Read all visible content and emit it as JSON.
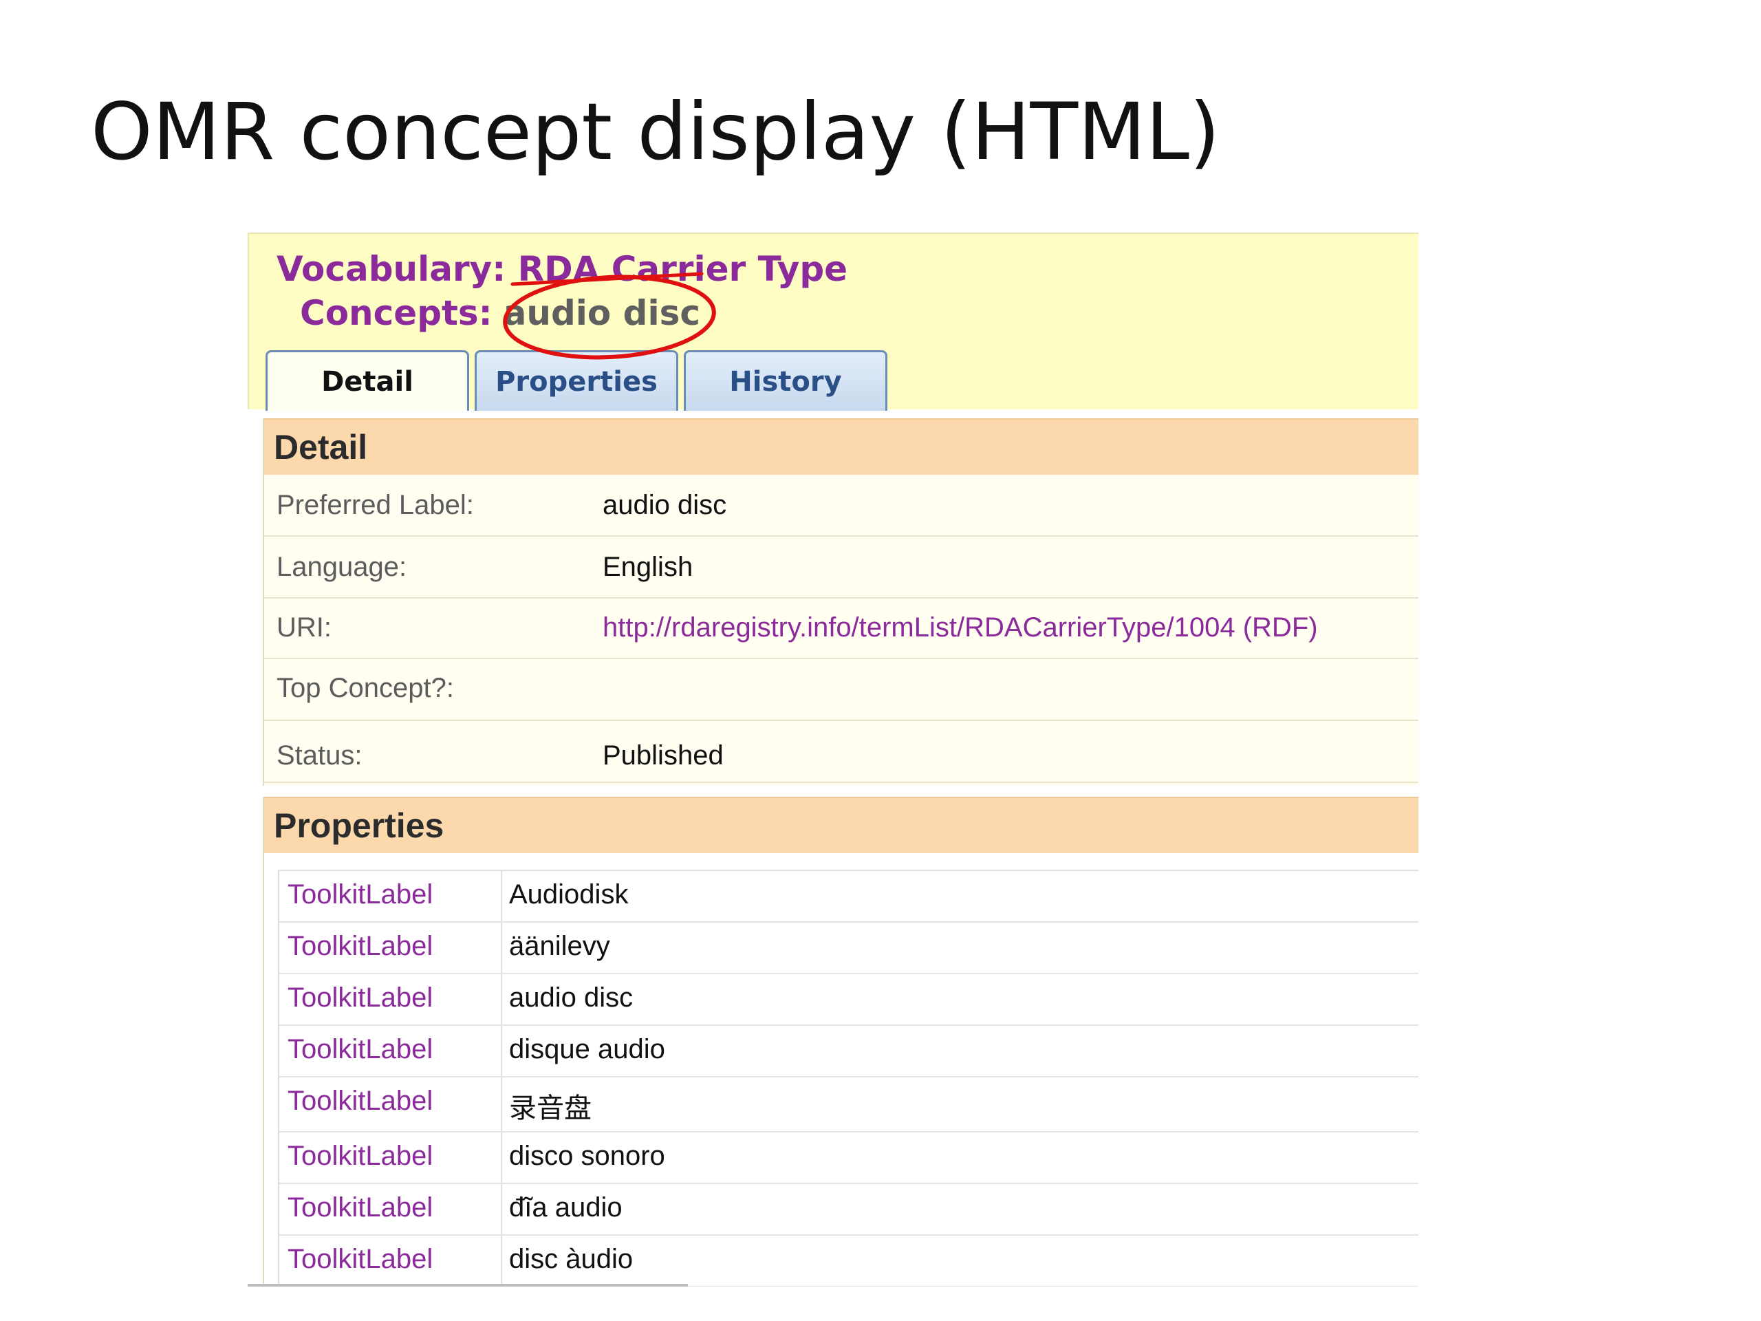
{
  "slide": {
    "title": "OMR concept display (HTML)"
  },
  "header": {
    "vocabulary_text": "Vocabulary: RDA Carrier Type",
    "concepts_label": "Concepts:",
    "concept_name": "audio disc",
    "circle_color": "#e01010"
  },
  "tabs": [
    {
      "label": "Detail",
      "active": true
    },
    {
      "label": "Properties",
      "active": false
    },
    {
      "label": "History",
      "active": false
    }
  ],
  "detail": {
    "heading": "Detail",
    "rows": [
      {
        "label": "Preferred Label:",
        "value": "audio disc"
      },
      {
        "label": "Language:",
        "value": "English"
      },
      {
        "label": "URI:",
        "value": "http://rdaregistry.info/termList/RDACarrierType/1004 (RDF)"
      },
      {
        "label": "Top Concept?:",
        "value": ""
      },
      {
        "label": "Status:",
        "value": "Published"
      }
    ]
  },
  "properties": {
    "heading": "Properties",
    "rows": [
      {
        "label": "ToolkitLabel",
        "value": "Audiodisk"
      },
      {
        "label": "ToolkitLabel",
        "value": "äänilevy"
      },
      {
        "label": "ToolkitLabel",
        "value": "audio disc"
      },
      {
        "label": "ToolkitLabel",
        "value": "disque audio"
      },
      {
        "label": "ToolkitLabel",
        "value": "录音盘"
      },
      {
        "label": "ToolkitLabel",
        "value": "disco sonoro"
      },
      {
        "label": "ToolkitLabel",
        "value": "đĩa audio"
      },
      {
        "label": "ToolkitLabel",
        "value": "disc àudio"
      }
    ]
  },
  "colors": {
    "header_bg": "#fdfdc4",
    "section_head_bg": "#fcd9ad",
    "link_purple": "#8b2a9b",
    "tab_blue": "#2a4f86"
  }
}
